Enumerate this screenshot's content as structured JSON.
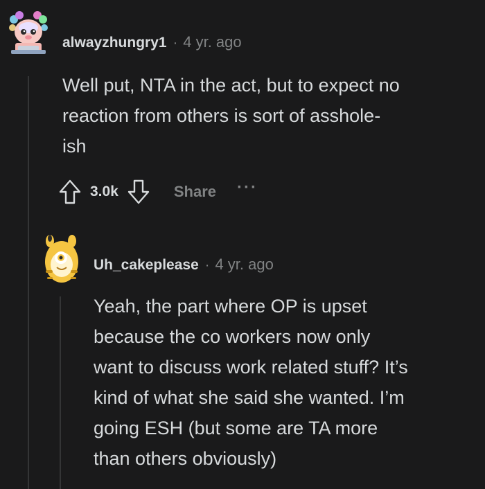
{
  "comment1": {
    "username": "alwayzhungry1",
    "separator": "·",
    "age": "4 yr. ago",
    "body_lines": [
      "Well put, NTA in the act, but to expect no",
      "reaction from others is sort of asshole-",
      "ish"
    ],
    "score": "3.0k",
    "share_label": "Share",
    "more_label": "···",
    "avatar_icon": "axolotl-avatar-icon"
  },
  "comment2": {
    "username": "Uh_cakeplease",
    "separator": "·",
    "age": "4 yr. ago",
    "body_lines": [
      "Yeah, the part where OP is upset",
      "because the co workers now only",
      "want to discuss work related stuff? It’s",
      "kind of what she said she wanted. I’m",
      "going ESH (but some are TA more",
      "than others obviously)"
    ],
    "avatar_icon": "yellow-critter-avatar-icon"
  },
  "colors": {
    "background": "#1a1a1b",
    "text": "#d7dadc",
    "muted": "#818384",
    "thread_line": "#343536"
  }
}
